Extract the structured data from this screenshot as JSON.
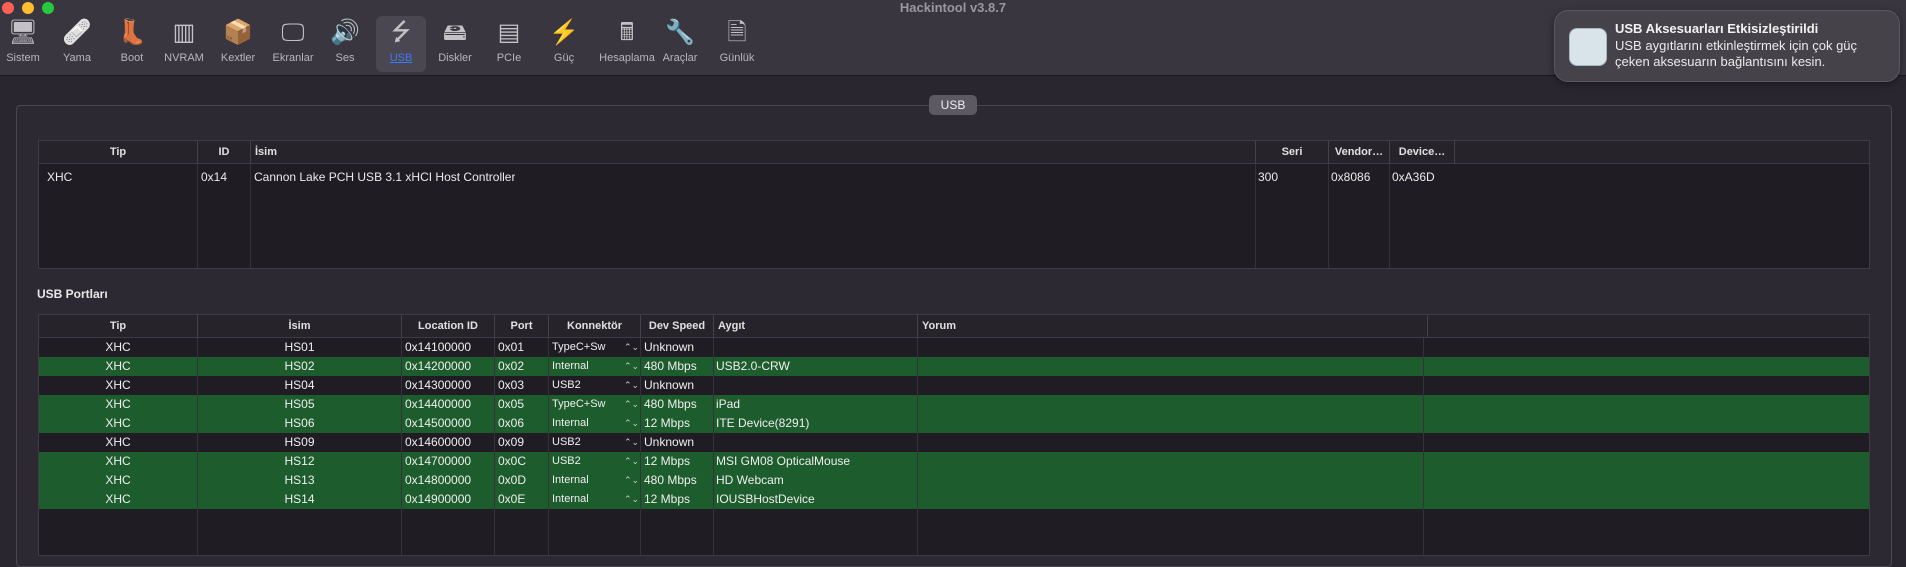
{
  "window": {
    "title": "Hackintool v3.8.7"
  },
  "toolbar": {
    "items": [
      {
        "label": "Sistem",
        "icon": "computer-icon",
        "glyph": "🖥"
      },
      {
        "label": "Yama",
        "icon": "bandage-icon",
        "glyph": "🩹"
      },
      {
        "label": "Boot",
        "icon": "boot-icon",
        "glyph": "👢"
      },
      {
        "label": "NVRAM",
        "icon": "memory-icon",
        "glyph": "▥"
      },
      {
        "label": "Kextler",
        "icon": "box-icon",
        "glyph": "📦"
      },
      {
        "label": "Ekranlar",
        "icon": "display-icon",
        "glyph": "🖵"
      },
      {
        "label": "Ses",
        "icon": "speaker-icon",
        "glyph": "🔊"
      },
      {
        "label": "USB",
        "icon": "usb-icon",
        "glyph": "⭍"
      },
      {
        "label": "Diskler",
        "icon": "disk-icon",
        "glyph": "🖴"
      },
      {
        "label": "PCIe",
        "icon": "pcie-icon",
        "glyph": "▤"
      },
      {
        "label": "Güç",
        "icon": "power-icon",
        "glyph": "⚡"
      },
      {
        "label": "Hesaplama",
        "icon": "calculator-icon",
        "glyph": "🖩"
      },
      {
        "label": "Araçlar",
        "icon": "wrench-icon",
        "glyph": "🔧"
      },
      {
        "label": "Günlük",
        "icon": "log-icon",
        "glyph": "🗎"
      }
    ],
    "active": "USB"
  },
  "notification": {
    "title": "USB Aksesuarları Etkisizleştirildi",
    "body": "USB aygıtlarını etkinleştirmek için çok güç çeken aksesuarın bağlantısını kesin."
  },
  "panel": {
    "label": "USB"
  },
  "controllers": {
    "headers": {
      "tip": "Tip",
      "id": "ID",
      "isim": "İsim",
      "seri": "Seri",
      "vendor": "Vendor…",
      "device": "Device…"
    },
    "rows": [
      {
        "tip": "XHC",
        "id": "0x14",
        "isim": "Cannon Lake PCH USB 3.1 xHCI Host Controller",
        "seri": "300",
        "vendor": "0x8086",
        "device": "0xA36D"
      }
    ]
  },
  "ports": {
    "section_title": "USB Portları",
    "headers": {
      "tip": "Tip",
      "isim": "İsim",
      "location": "Location ID",
      "port": "Port",
      "konnektor": "Konnektör",
      "speed": "Dev Speed",
      "aygit": "Aygıt",
      "yorum": "Yorum"
    },
    "rows": [
      {
        "tip": "XHC",
        "isim": "HS01",
        "location": "0x14100000",
        "port": "0x01",
        "konnektor": "TypeC+Sw",
        "speed": "Unknown",
        "aygit": "",
        "highlight": false
      },
      {
        "tip": "XHC",
        "isim": "HS02",
        "location": "0x14200000",
        "port": "0x02",
        "konnektor": "Internal",
        "speed": "480 Mbps",
        "aygit": "USB2.0-CRW",
        "highlight": true
      },
      {
        "tip": "XHC",
        "isim": "HS04",
        "location": "0x14300000",
        "port": "0x03",
        "konnektor": "USB2",
        "speed": "Unknown",
        "aygit": "",
        "highlight": false
      },
      {
        "tip": "XHC",
        "isim": "HS05",
        "location": "0x14400000",
        "port": "0x05",
        "konnektor": "TypeC+Sw",
        "speed": "480 Mbps",
        "aygit": "iPad",
        "highlight": true
      },
      {
        "tip": "XHC",
        "isim": "HS06",
        "location": "0x14500000",
        "port": "0x06",
        "konnektor": "Internal",
        "speed": "12 Mbps",
        "aygit": "ITE Device(8291)",
        "highlight": true
      },
      {
        "tip": "XHC",
        "isim": "HS09",
        "location": "0x14600000",
        "port": "0x09",
        "konnektor": "USB2",
        "speed": "Unknown",
        "aygit": "",
        "highlight": false
      },
      {
        "tip": "XHC",
        "isim": "HS12",
        "location": "0x14700000",
        "port": "0x0C",
        "konnektor": "USB2",
        "speed": "12 Mbps",
        "aygit": "MSI GM08 OpticalMouse",
        "highlight": true
      },
      {
        "tip": "XHC",
        "isim": "HS13",
        "location": "0x14800000",
        "port": "0x0D",
        "konnektor": "Internal",
        "speed": "480 Mbps",
        "aygit": "HD Webcam",
        "highlight": true
      },
      {
        "tip": "XHC",
        "isim": "HS14",
        "location": "0x14900000",
        "port": "0x0E",
        "konnektor": "Internal",
        "speed": "12 Mbps",
        "aygit": "IOUSBHostDevice",
        "highlight": true
      }
    ]
  },
  "colors": {
    "highlight_row": "#1d5c2c",
    "accent": "#3d7bf5"
  }
}
